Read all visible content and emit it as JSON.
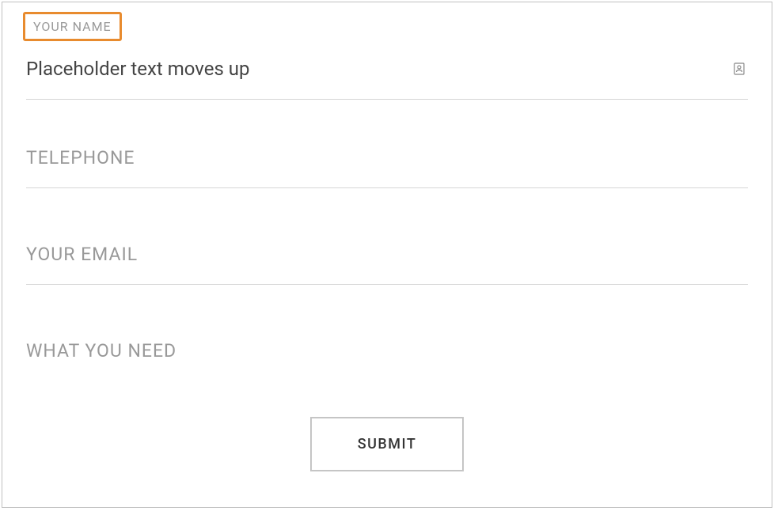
{
  "form": {
    "name": {
      "label": "YOUR NAME",
      "value": "Placeholder text moves up"
    },
    "telephone": {
      "placeholder": "TELEPHONE"
    },
    "email": {
      "placeholder": "YOUR EMAIL"
    },
    "need": {
      "placeholder": "WHAT YOU NEED"
    },
    "submit": {
      "label": "SUBMIT"
    }
  }
}
